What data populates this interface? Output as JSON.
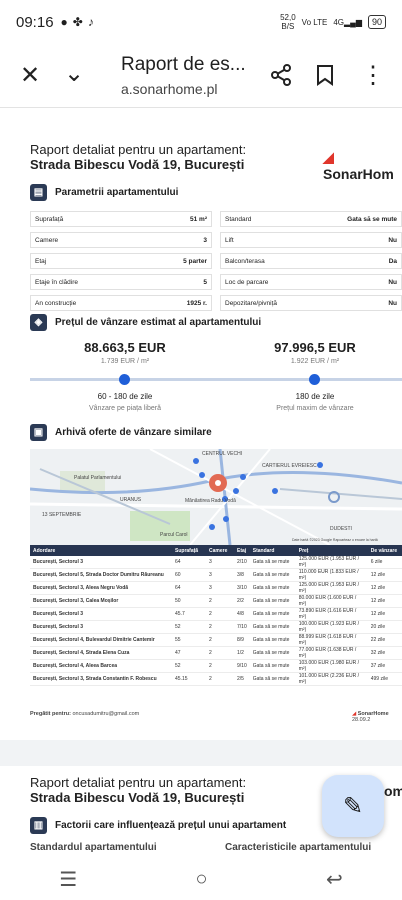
{
  "status": {
    "time": "09:16",
    "net_speed": "52,0",
    "net_unit": "B/S",
    "volte": "Vo LTE",
    "signal": "4G",
    "battery": "90"
  },
  "header": {
    "title": "Raport de es...",
    "url": "a.sonarhome.pl"
  },
  "doc": {
    "title_line1": "Raport detaliat pentru un apartament:",
    "title_line2": "Strada Bibescu Vodă 19, București",
    "brand": "SonarHom",
    "params_heading": "Parametrii apartamentului",
    "params_left": [
      {
        "label": "Suprafață",
        "value": "51 m²"
      },
      {
        "label": "Camere",
        "value": "3"
      },
      {
        "label": "Etaj",
        "value": "5 parter"
      },
      {
        "label": "Etaje în clădire",
        "value": "5"
      },
      {
        "label": "An construcție",
        "value": "1925 r."
      }
    ],
    "params_right": [
      {
        "label": "Standard",
        "value": "Gata să se mute"
      },
      {
        "label": "Lift",
        "value": "Nu"
      },
      {
        "label": "Balcon/terasa",
        "value": "Da"
      },
      {
        "label": "Loc de parcare",
        "value": "Nu"
      },
      {
        "label": "Depozitare/pivniță",
        "value": "Nu"
      }
    ],
    "price_heading": "Prețul de vânzare estimat al apartamentului",
    "price_left": {
      "value": "88.663,5 EUR",
      "per_m": "1.739 EUR / m²",
      "days": "60 - 180 de zile",
      "caption": "Vânzare pe piața liberă"
    },
    "price_right": {
      "value": "97.996,5 EUR",
      "per_m": "1.922 EUR / m²",
      "days": "180 de zile",
      "caption": "Prețul maxim de vânzare"
    },
    "archive_heading": "Arhivă oferte de vânzare similare",
    "map_labels": {
      "centru": "CENTRUL VECHI",
      "cartier": "CARTIERUL EVREIESC",
      "palat": "Palatul Parlamentului",
      "sept": "13 SEPTEMBRIE",
      "uranus": "URANUS",
      "manastirea": "Mănăstirea Radu Vodă",
      "parc": "Parcul Carol",
      "dudesti": "DUDESTI",
      "credit": "Date hartă ©2023 Google   Rapoarteaz o eroare la hartă"
    },
    "table_headers": [
      "Adordare",
      "Suprafață",
      "Camere",
      "Etaj",
      "Standard",
      "Preț",
      "De vânzare"
    ],
    "table_rows": [
      [
        "București, Sectorul 3",
        "64",
        "3",
        "2/10",
        "Gata să se mute",
        "125.000 EUR (1.953 EUR / m²)",
        "6 zile"
      ],
      [
        "București, Sectorul 5, Strada Doctor Dumitru Răureanu",
        "60",
        "3",
        "3/8",
        "Gata să se mute",
        "110.000 EUR (1.833 EUR / m²)",
        "12 zile"
      ],
      [
        "București, Sectorul 3, Aleea Negru Vodă",
        "64",
        "3",
        "3/10",
        "Gata să se mute",
        "125.000 EUR (1.953 EUR / m²)",
        "12 zile"
      ],
      [
        "București, Sectorul 3, Calea Moșilor",
        "50",
        "2",
        "2/2",
        "Gata să se mute",
        "80.000 EUR (1.600 EUR / m²)",
        "12 zile"
      ],
      [
        "București, Sectorul 3",
        "45.7",
        "2",
        "4/8",
        "Gata să se mute",
        "73.890 EUR (1.616 EUR / m²)",
        "12 zile"
      ],
      [
        "București, Sectorul 3",
        "52",
        "2",
        "7/10",
        "Gata să se mute",
        "100.000 EUR (1.923 EUR / m²)",
        "20 zile"
      ],
      [
        "București, Sectorul 4, Bulevardul Dimitrie Cantemir",
        "55",
        "2",
        "8/9",
        "Gata să se mute",
        "88.999 EUR (1.618 EUR / m²)",
        "22 zile"
      ],
      [
        "București, Sectorul 4, Strada Elena Cuza",
        "47",
        "2",
        "1/2",
        "Gata să se mute",
        "77.000 EUR (1.638 EUR / m²)",
        "32 zile"
      ],
      [
        "București, Sectorul 4, Aleea Barcea",
        "52",
        "2",
        "9/10",
        "Gata să se mute",
        "103.000 EUR (1.980 EUR / m²)",
        "37 zile"
      ],
      [
        "București, Sectorul 3, Strada Constantin F. Robescu",
        "45.15",
        "2",
        "2/5",
        "Gata să se mute",
        "101.000 EUR (2.236 EUR / m²)",
        "499 zile"
      ]
    ],
    "footer_prepared": "Pregătit pentru:",
    "footer_email": "oncusadumitru@gmail.com",
    "footer_brand": "SonarHome",
    "footer_date": "28.09.2"
  },
  "doc2": {
    "title_line1": "Raport detaliat pentru un apartament:",
    "title_line2": "Strada Bibescu Vodă 19, București",
    "brand": "om",
    "factors_heading": "Factorii care influențează prețul unui apartament",
    "col1": "Standardul apartamentului",
    "col2": "Caracteristicile apartamentului"
  }
}
